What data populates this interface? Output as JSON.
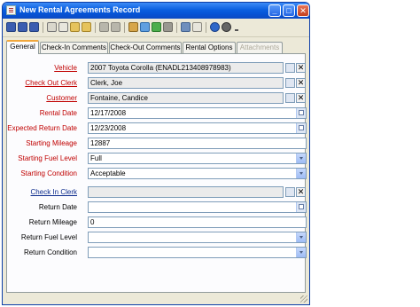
{
  "window": {
    "title": "New Rental Agreements Record",
    "buttons": {
      "minimize": "_",
      "maximize": "□",
      "close": "✕"
    }
  },
  "toolbar": {
    "icons": [
      "save-icon",
      "save-close-icon",
      "save-new-icon",
      "print-icon",
      "print-preview-icon",
      "attach-icon",
      "first-record-icon",
      "previous-record-icon",
      "copy-icon",
      "paste-icon",
      "refresh-icon",
      "undo-icon",
      "link-icon",
      "note-icon",
      "help-icon",
      "info-icon"
    ]
  },
  "tabs": [
    {
      "label": "General",
      "active": true
    },
    {
      "label": "Check-In Comments"
    },
    {
      "label": "Check-Out Comments"
    },
    {
      "label": "Rental Options"
    },
    {
      "label": "Attachments",
      "disabled": true
    }
  ],
  "form": {
    "vehicle": {
      "label": "Vehicle",
      "value": "2007 Toyota Corolla (ENADL213408978983)"
    },
    "check_out_clerk": {
      "label": "Check Out Clerk",
      "value": "Clerk, Joe"
    },
    "customer": {
      "label": "Customer",
      "value": "Fontaine, Candice"
    },
    "rental_date": {
      "label": "Rental Date",
      "value": "12/17/2008"
    },
    "expected_return_date": {
      "label": "Expected Return Date",
      "value": "12/23/2008"
    },
    "starting_mileage": {
      "label": "Starting Mileage",
      "value": "12887"
    },
    "starting_fuel_level": {
      "label": "Starting Fuel Level",
      "value": "Full"
    },
    "starting_condition": {
      "label": "Starting Condition",
      "value": "Acceptable"
    },
    "check_in_clerk": {
      "label": "Check In Clerk",
      "value": ""
    },
    "return_date": {
      "label": "Return Date",
      "value": ""
    },
    "return_mileage": {
      "label": "Return Mileage",
      "value": "0"
    },
    "return_fuel_level": {
      "label": "Return Fuel Level",
      "value": ""
    },
    "return_condition": {
      "label": "Return Condition",
      "value": ""
    }
  },
  "colors": {
    "required_label": "#c00000",
    "title_bar": "#0a5fe0",
    "active_tab_accent": "#f1a73c"
  }
}
